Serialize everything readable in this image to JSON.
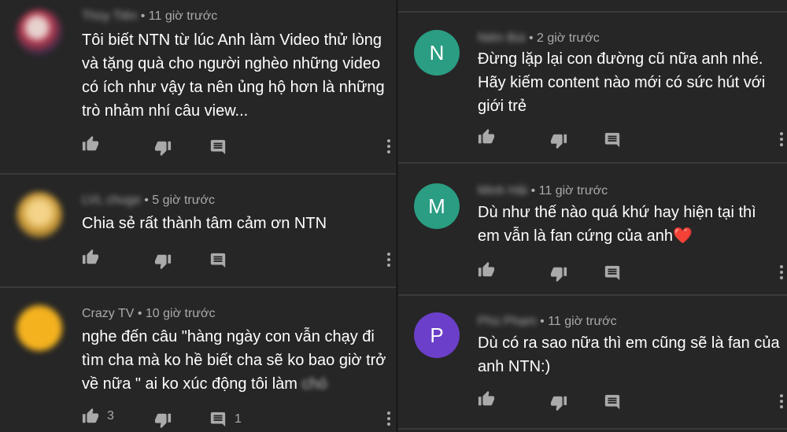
{
  "icons": {
    "like": "thumb-up-icon",
    "dislike": "thumb-down-icon",
    "reply": "comment-icon",
    "more": "more-vertical-icon"
  },
  "left_comments": [
    {
      "author": "Thùy Tiên",
      "time": "11 giờ trước",
      "text": "Tôi biết NTN từ lúc Anh làm Video thử lòng và tặng quà cho người nghèo những video có ích như vậy ta nên ủng hộ hơn là những trò nhảm nhí câu view..."
    },
    {
      "author": "LVL chuge",
      "time": "5 giờ trước",
      "text": "Chia sẻ rất thành tâm cảm ơn NTN"
    },
    {
      "author": "Crazy TV",
      "time": "10 giờ trước",
      "text": "nghe đến câu \"hàng ngày con vẫn chạy đi tìm cha mà ko hề biết cha sẽ ko bao giờ trở về nữa \"  ai ko xúc động tôi làm",
      "text_tail": "chó",
      "likes": "3",
      "replies": "1"
    }
  ],
  "right_comments": [
    {
      "avatar_letter": "N",
      "avatar_color": "#2a9d82",
      "author": "Niên Bùi",
      "time": "2 giờ trước",
      "text": "Đừng lặp lại con đường cũ nữa anh nhé. Hãy kiếm content nào mới có sức hút với giới trẻ"
    },
    {
      "avatar_letter": "M",
      "avatar_color": "#2a9d82",
      "author": "Minh Hải",
      "time": "11 giờ trước",
      "text": "Dù như thế nào quá khứ hay hiện tại thì em vẫn là fan cứng của anh❤️"
    },
    {
      "avatar_letter": "P",
      "avatar_color": "#6b3fc9",
      "author": "Phú Phạm",
      "time": "11 giờ trước",
      "text": "Dù  có ra sao nữa thì em cũng sẽ là fan của anh NTN:)"
    }
  ]
}
